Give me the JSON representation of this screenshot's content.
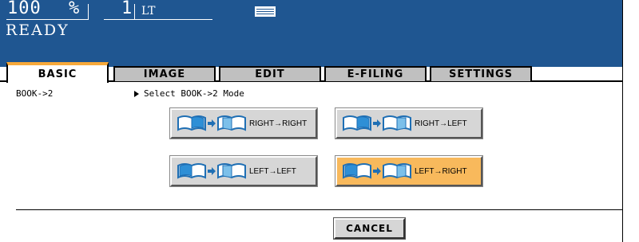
{
  "status": {
    "zoom_value": "100",
    "zoom_unit": "%",
    "copies": "1",
    "paper_size": "LT",
    "paper_icon": "paper-tray-icon",
    "state": "READY"
  },
  "tabs": [
    {
      "label": "BASIC",
      "active": true
    },
    {
      "label": "IMAGE",
      "active": false
    },
    {
      "label": "EDIT",
      "active": false
    },
    {
      "label": "E-FILING",
      "active": false
    },
    {
      "label": "SETTINGS",
      "active": false
    }
  ],
  "content": {
    "function_label": "BOOK->2",
    "prompt": "Select BOOK->2 Mode",
    "options": [
      {
        "label": "RIGHT→RIGHT",
        "selected": false,
        "icon": "book-right-to-right-icon"
      },
      {
        "label": "RIGHT→LEFT",
        "selected": false,
        "icon": "book-right-to-left-icon"
      },
      {
        "label": "LEFT→LEFT",
        "selected": false,
        "icon": "book-left-to-left-icon"
      },
      {
        "label": "LEFT→RIGHT",
        "selected": true,
        "icon": "book-left-to-right-icon"
      }
    ]
  },
  "footer": {
    "cancel_label": "CANCEL"
  },
  "colors": {
    "status_bg": "#1f5691",
    "tab_gray": "#c0c0c0",
    "selected": "#f8b95c",
    "active_tab_accent": "#f7a93a"
  }
}
